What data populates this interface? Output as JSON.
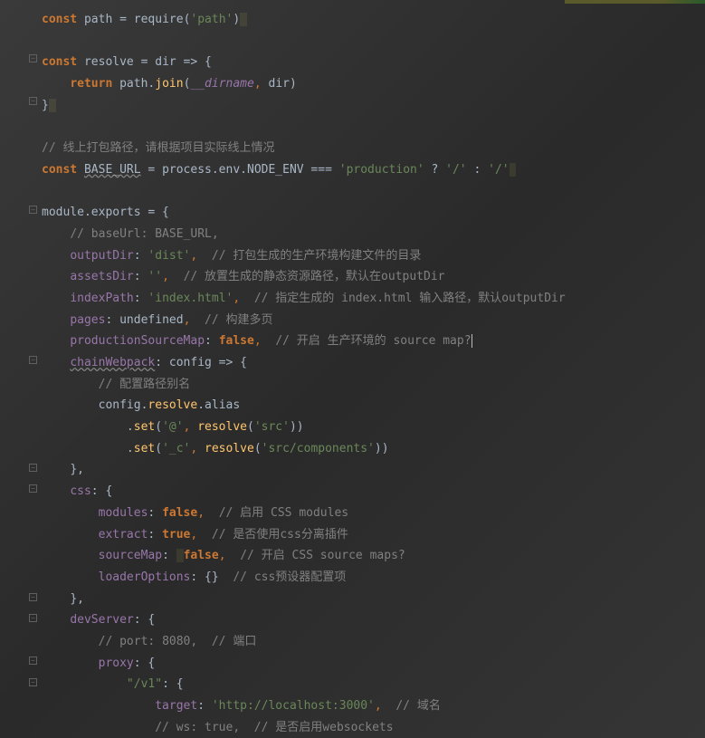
{
  "lines": {
    "l1": {
      "const": "const",
      "var": "path",
      "eq": " = ",
      "req": "require",
      "open": "(",
      "str": "'path'",
      "close": ")"
    },
    "l3": {
      "const": "const",
      "var": "resolve",
      "eq": " = ",
      "param": "dir",
      "arrow": " => {",
      "open": ""
    },
    "l4": {
      "ret": "return",
      "obj": " path.",
      "fn": "join",
      "open": "(",
      "g": "__dirname",
      "comma": ", ",
      "p": "dir",
      "close": ")"
    },
    "l5": {
      "close": "}"
    },
    "l7": {
      "comment": "// 线上打包路径，请根据项目实际线上情况"
    },
    "l8": {
      "const": "const",
      "var": "BASE_URL",
      "eq": " = process.env.NODE_ENV === ",
      "str": "'production'",
      "q": " ? ",
      "s1": "'/'",
      "colon": " : ",
      "s2": "'/'"
    },
    "l10": {
      "text": "module.exports = {"
    },
    "l11": {
      "comment": "// baseUrl: BASE_URL,"
    },
    "l12": {
      "key": "outputDir",
      "colon": ": ",
      "val": "'dist'",
      "comma": ",  ",
      "comment": "// 打包生成的生产环境构建文件的目录"
    },
    "l13": {
      "key": "assetsDir",
      "colon": ": ",
      "val": "''",
      "comma": ",  ",
      "comment": "// 放置生成的静态资源路径，默认在outputDir"
    },
    "l14": {
      "key": "indexPath",
      "colon": ": ",
      "val": "'index.html'",
      "comma": ",  ",
      "comment": "// 指定生成的 index.html 输入路径，默认outputDir"
    },
    "l15": {
      "key": "pages",
      "colon": ": ",
      "val": "undefined",
      "comma": ",  ",
      "comment": "// 构建多页"
    },
    "l16": {
      "key": "productionSourceMap",
      "colon": ": ",
      "val": "false",
      "comma": ",  ",
      "comment": "// 开启 生产环境的 source map?"
    },
    "l17": {
      "key": "chainWebpack",
      "colon": ": ",
      "param": "config",
      "arrow": " => {"
    },
    "l18": {
      "comment": "// 配置路径别名"
    },
    "l19": {
      "obj": "config.",
      "fn": "resolve",
      "rest": ".alias"
    },
    "l20": {
      "dot": ".",
      "fn": "set",
      "open": "(",
      "s1": "'@'",
      "comma": ", ",
      "fn2": "resolve",
      "open2": "(",
      "s2": "'src'",
      "close": "))"
    },
    "l21": {
      "dot": ".",
      "fn": "set",
      "open": "(",
      "s1": "'_c'",
      "comma": ", ",
      "fn2": "resolve",
      "open2": "(",
      "s2": "'src/components'",
      "close": "))"
    },
    "l22": {
      "close": "},",
      "comma": ""
    },
    "l23": {
      "key": "css",
      "colon": ": {",
      "open": ""
    },
    "l24": {
      "key": "modules",
      "colon": ": ",
      "val": "false",
      "comma": ",  ",
      "comment": "// 启用 CSS modules"
    },
    "l25": {
      "key": "extract",
      "colon": ": ",
      "val": "true",
      "comma": ",  ",
      "comment": "// 是否使用css分离插件"
    },
    "l26": {
      "key": "sourceMap",
      "colon": ": ",
      "val": "false",
      "comma": ",  ",
      "comment": "// 开启 CSS source maps?"
    },
    "l27": {
      "key": "loaderOptions",
      "colon": ": {}  ",
      "comment": "// css预设器配置项"
    },
    "l28": {
      "close": "},",
      "comma": ""
    },
    "l29": {
      "key": "devServer",
      "colon": ": {",
      "open": ""
    },
    "l30": {
      "comment": "// port: 8080,  // 端口"
    },
    "l31": {
      "key": "proxy",
      "colon": ": {",
      "open": ""
    },
    "l32": {
      "key": "\"/v1\"",
      "colon": ": {",
      "open": ""
    },
    "l33": {
      "key": "target",
      "colon": ": ",
      "val": "'http://localhost:3000'",
      "comma": ",  ",
      "comment": "// 域名"
    },
    "l34": {
      "comment": "// ws: true,  // 是否启用websockets"
    }
  }
}
